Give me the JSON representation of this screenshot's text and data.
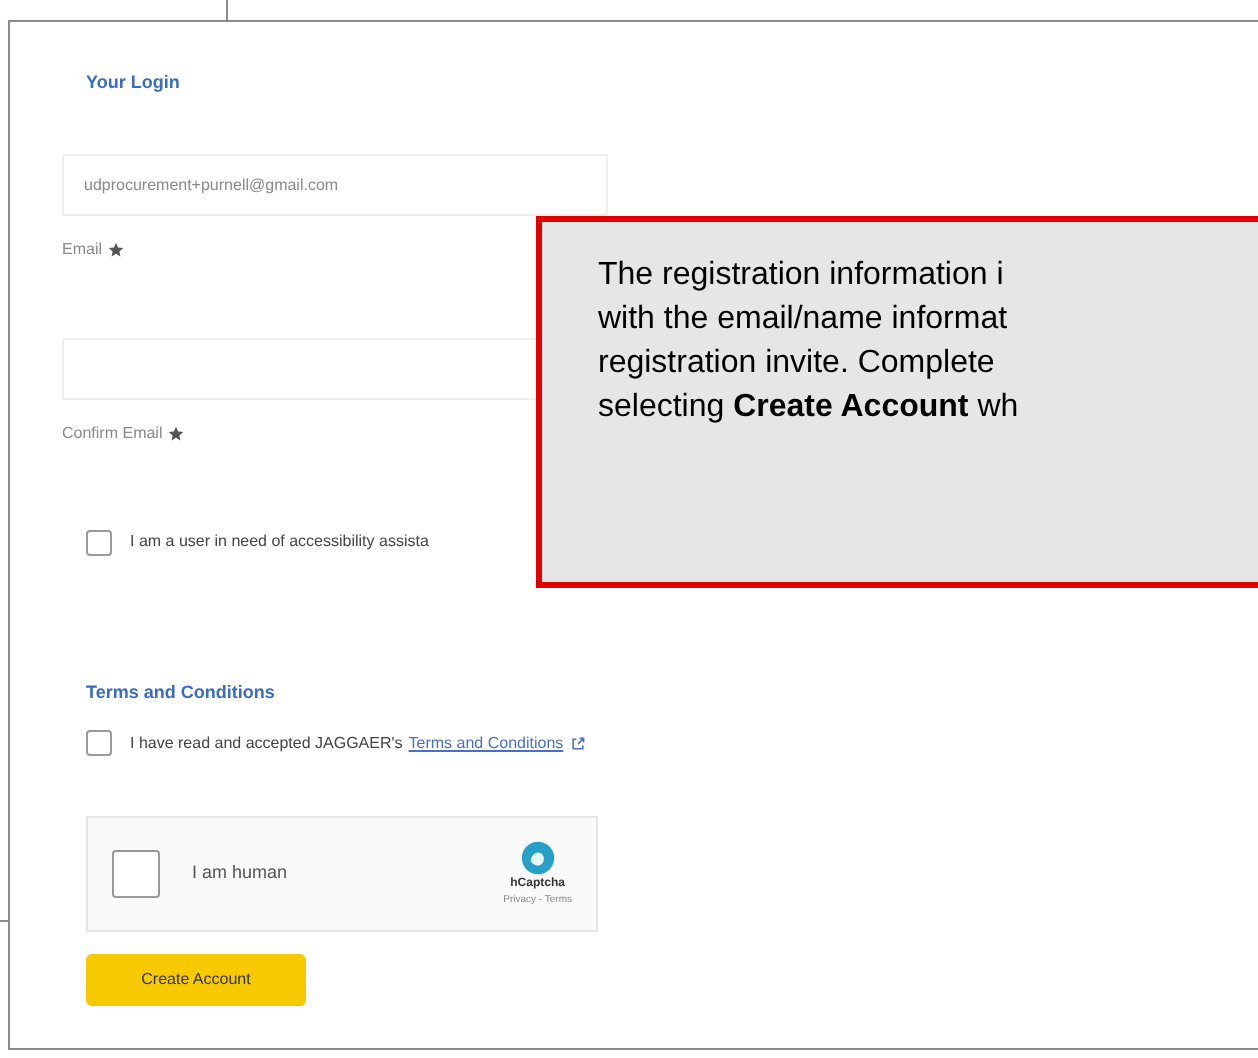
{
  "section_title": "Your Login",
  "fields": [
    {
      "label": "Email",
      "value": "udprocurement+purnell@gmail.com",
      "required": true
    },
    {
      "label": "Confirm Email",
      "required": true
    }
  ],
  "accessibility_checkbox": {
    "label": "I am a user in need of accessibility assista",
    "checked": false
  },
  "terms": {
    "title": "Terms and Conditions",
    "text": "I have read and accepted JAGGAER's",
    "link": "Terms and Conditions",
    "checked": false
  },
  "captcha": {
    "label": "I am human",
    "brand": "hCaptcha",
    "footer": "Privacy - Terms",
    "checked": false
  },
  "create_button": "Create Account",
  "callout": {
    "lines": [
      "The registration information i",
      "with the email/name informat",
      "registration invite. Complete",
      "selecting **Create Account** wh"
    ]
  }
}
